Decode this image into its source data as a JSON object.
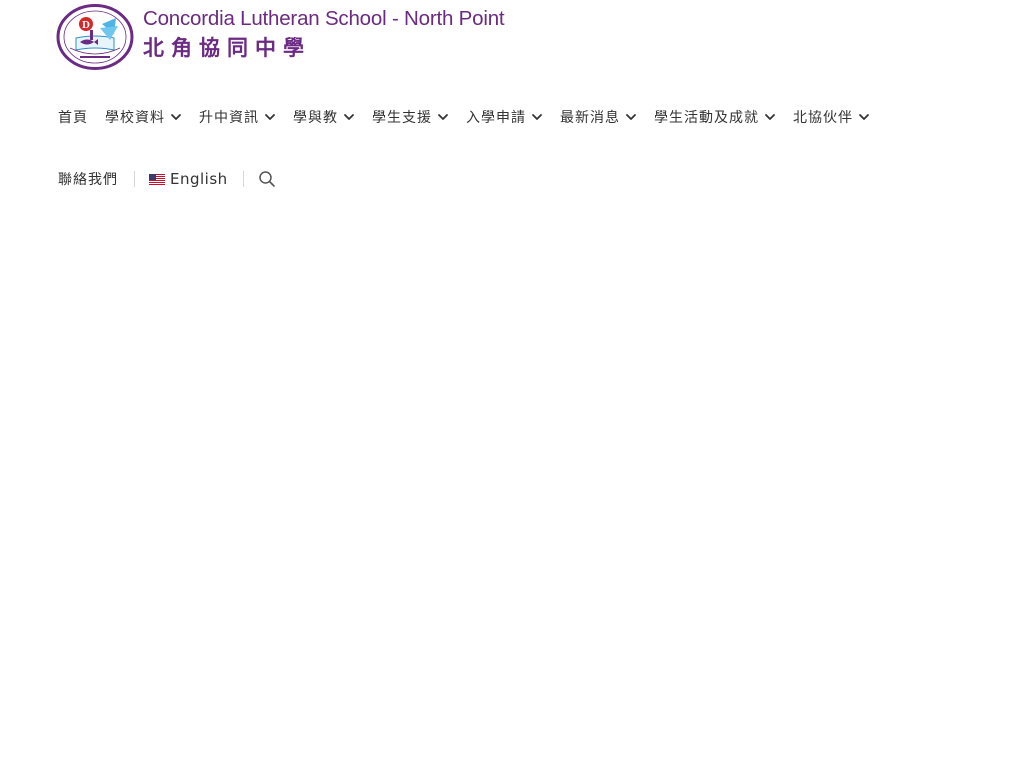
{
  "site": {
    "name_en": "Concordia Lutheran School - North Point",
    "name_zh": "北角協同中學",
    "brand_color": "#6b2a83"
  },
  "nav": {
    "items": [
      {
        "label": "首頁",
        "has_dropdown": false
      },
      {
        "label": "學校資料",
        "has_dropdown": true
      },
      {
        "label": "升中資訊",
        "has_dropdown": true
      },
      {
        "label": "學與教",
        "has_dropdown": true
      },
      {
        "label": "學生支援",
        "has_dropdown": true
      },
      {
        "label": "入學申請",
        "has_dropdown": true
      },
      {
        "label": "最新消息",
        "has_dropdown": true
      },
      {
        "label": "學生活動及成就",
        "has_dropdown": true
      },
      {
        "label": "北協伙伴",
        "has_dropdown": true
      }
    ],
    "contact_label": "聯絡我們",
    "language": {
      "label": "English",
      "flag_icon": "us-flag-icon"
    },
    "search_icon": "search-icon",
    "text_color": "#333333"
  }
}
